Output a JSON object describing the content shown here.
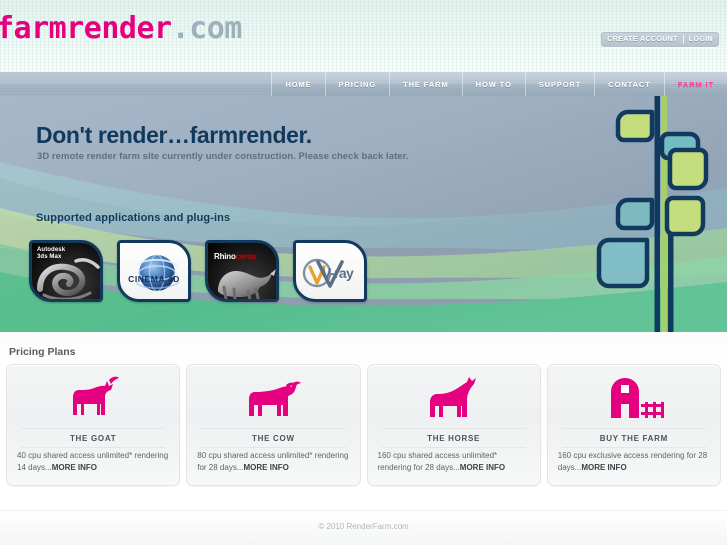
{
  "site": {
    "logo_main": "farmrender",
    "logo_dot": ".",
    "logo_com": "com"
  },
  "header": {
    "create_account_label": "CREATE ACCOUNT",
    "login_label": "LOGIN"
  },
  "nav": {
    "items": [
      {
        "label": "HOME",
        "accent": false
      },
      {
        "label": "PRICING",
        "accent": false
      },
      {
        "label": "THE FARM",
        "accent": false
      },
      {
        "label": "HOW TO",
        "accent": false
      },
      {
        "label": "SUPPORT",
        "accent": false
      },
      {
        "label": "CONTACT",
        "accent": false
      },
      {
        "label": "FARM IT",
        "accent": true
      }
    ]
  },
  "hero": {
    "title": "Don't render…farmrender.",
    "subtitle": "3D remote render farm site currently under construction. Please check back later.",
    "apps_label": "Supported applications and plug-ins",
    "apps": [
      {
        "name": "autodesk-3ds-max",
        "line1": "Autodesk",
        "line2": "3ds Max"
      },
      {
        "name": "cinema-4d",
        "text": "CINEMA 4D"
      },
      {
        "name": "rhinoceros",
        "word1": "Rhino",
        "word2": "ceros"
      },
      {
        "name": "v-ray",
        "text": "V-ray"
      }
    ]
  },
  "pricing": {
    "title": "Pricing Plans",
    "cards": [
      {
        "icon": "goat-icon",
        "name": "THE GOAT",
        "desc": "40 cpu shared access unlimited* rendering 14 days...",
        "more": "MORE INFO"
      },
      {
        "icon": "cow-icon",
        "name": "THE COW",
        "desc": "80 cpu shared access unlimited* rendering for 28 days...",
        "more": "MORE INFO"
      },
      {
        "icon": "horse-icon",
        "name": "THE HORSE",
        "desc": "160 cpu shared access unlimited* rendering for 28 days...",
        "more": "MORE INFO"
      },
      {
        "icon": "barn-icon",
        "name": "BUY THE FARM",
        "desc": "160 cpu exclusive access rendering for 28 days...",
        "more": "MORE INFO"
      }
    ]
  },
  "footer": {
    "copyright": "© 2010 RenderFarm.com"
  },
  "colors": {
    "brand_pink": "#e6007e",
    "animal_pink": "#e4007f",
    "hero_navy": "#12395c",
    "plant_outline": "#123a5e",
    "nav_bg": "#a9b8c7"
  }
}
